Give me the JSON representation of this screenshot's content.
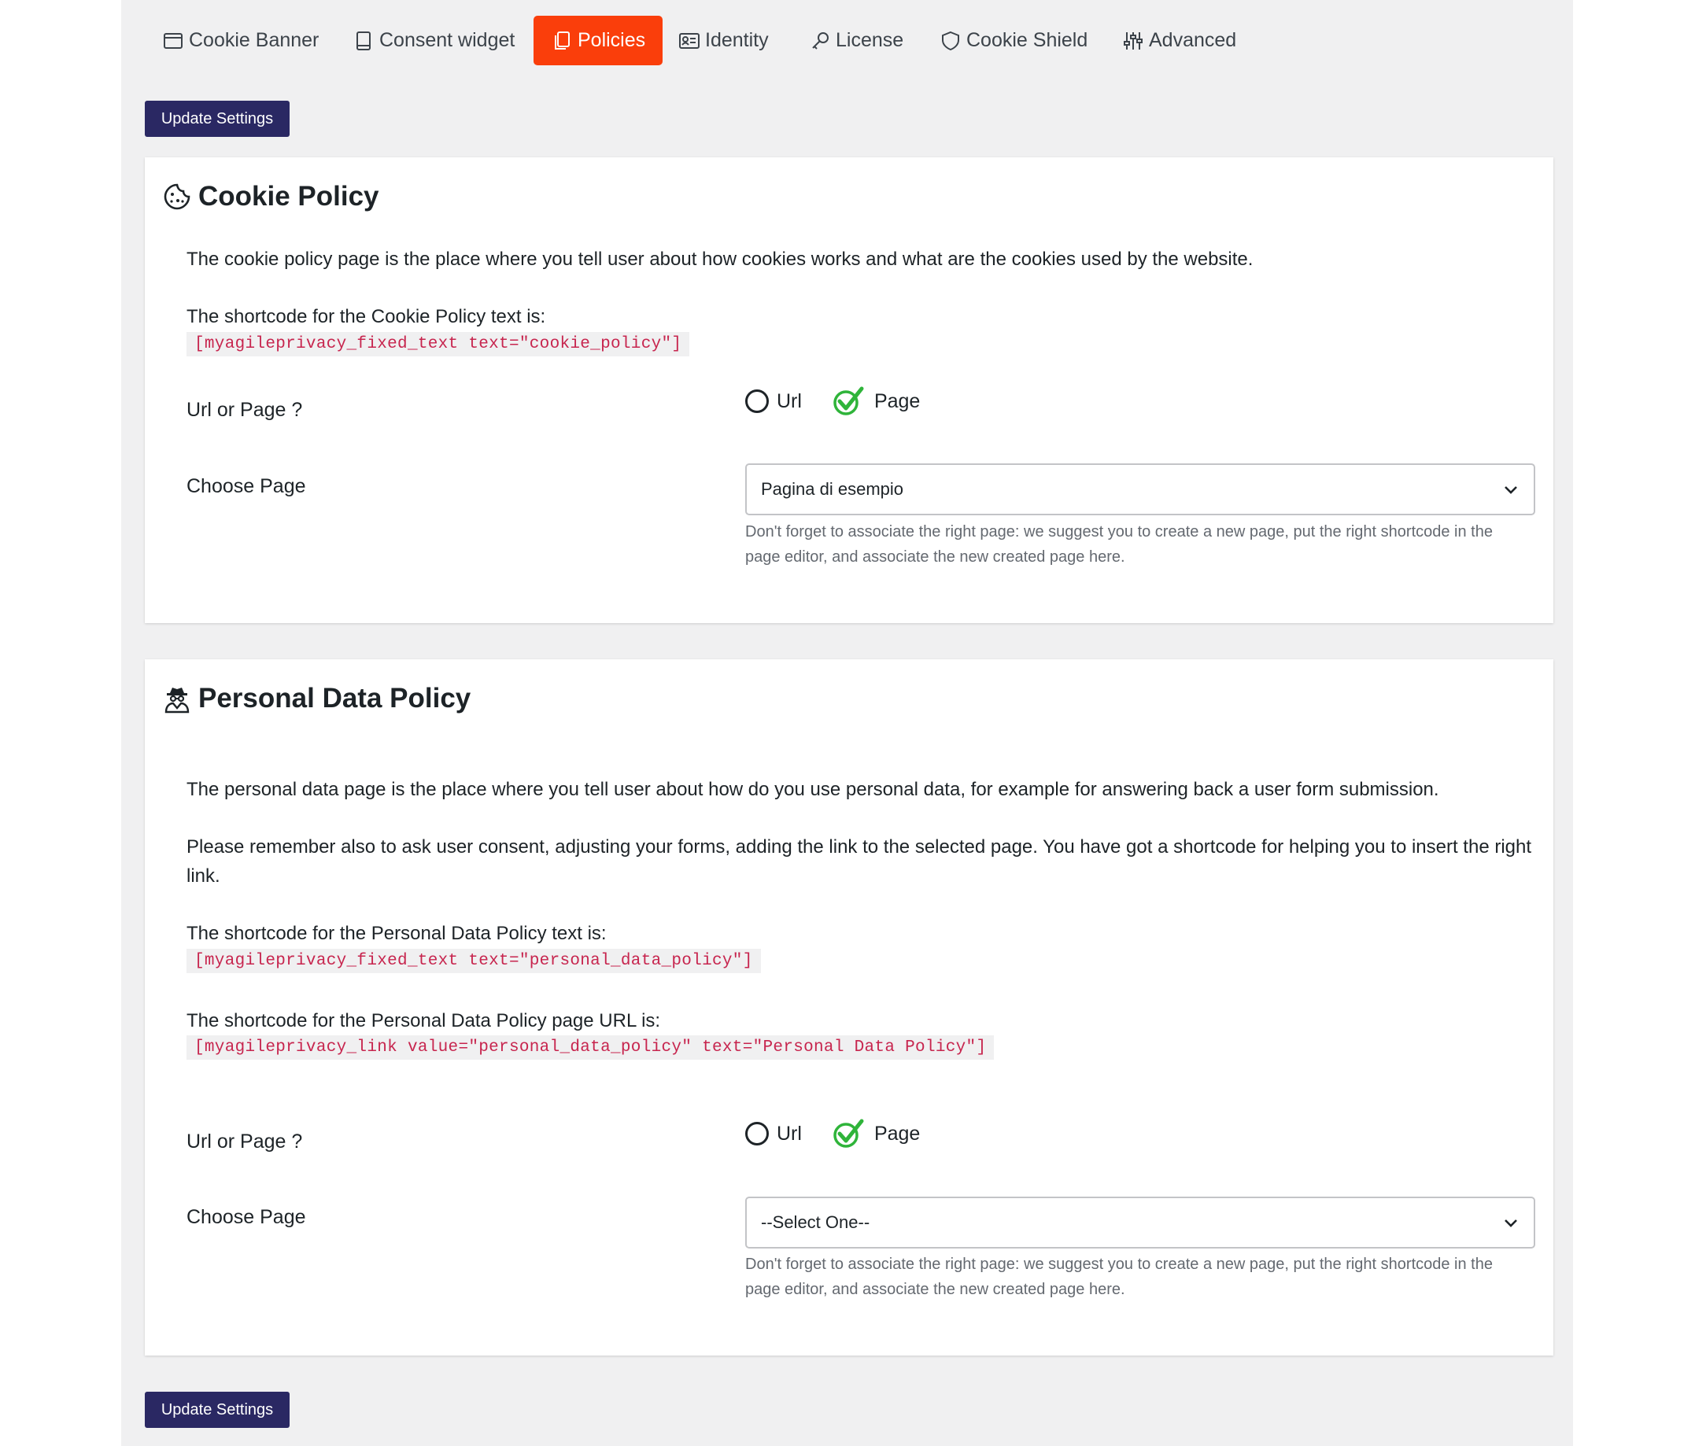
{
  "tabs": [
    {
      "label": "Cookie Banner",
      "icon": "window-icon"
    },
    {
      "label": "Consent widget",
      "icon": "tablet-icon"
    },
    {
      "label": "Policies",
      "icon": "documents-icon",
      "active": true
    },
    {
      "label": "Identity",
      "icon": "id-card-icon"
    },
    {
      "label": "License",
      "icon": "key-icon"
    },
    {
      "label": "Cookie Shield",
      "icon": "shield-icon"
    },
    {
      "label": "Advanced",
      "icon": "sliders-icon"
    }
  ],
  "update_button_label": "Update Settings",
  "cookie_policy": {
    "title": "Cookie Policy",
    "description": "The cookie policy page is the place where you tell user about how cookies works and what are the cookies used by the website.",
    "shortcode_label": "The shortcode for the Cookie Policy text is:",
    "shortcode": "[myagileprivacy_fixed_text text=\"cookie_policy\"]",
    "url_or_page_label": "Url or Page ?",
    "radio_url_label": "Url",
    "radio_page_label": "Page",
    "selected_option": "Page",
    "choose_page_label": "Choose Page",
    "select_value": "Pagina di esempio",
    "help_text": "Don't forget to associate the right page: we suggest you to create a new page, put the right shortcode in the page editor, and associate the new created page here."
  },
  "personal_data_policy": {
    "title": "Personal Data Policy",
    "description": "The personal data page is the place where you tell user about how do you use personal data, for example for answering back a user form submission.",
    "reminder": "Please remember also to ask user consent, adjusting your forms, adding the link to the selected page. You have got a shortcode for helping you to insert the right link.",
    "shortcode_label": "The shortcode for the Personal Data Policy text is:",
    "shortcode": "[myagileprivacy_fixed_text text=\"personal_data_policy\"]",
    "link_shortcode_label": "The shortcode for the Personal Data Policy page URL is:",
    "link_shortcode": "[myagileprivacy_link value=\"personal_data_policy\" text=\"Personal Data Policy\"]",
    "url_or_page_label": "Url or Page ?",
    "radio_url_label": "Url",
    "radio_page_label": "Page",
    "selected_option": "Page",
    "choose_page_label": "Choose Page",
    "select_value": "--Select One--",
    "help_text": "Don't forget to associate the right page: we suggest you to create a new page, put the right shortcode in the page editor, and associate the new created page here."
  },
  "colors": {
    "active_tab": "#fa3e0b",
    "button": "#2a2863",
    "shortcode_text": "#c7254e",
    "check": "#2fb43a"
  }
}
